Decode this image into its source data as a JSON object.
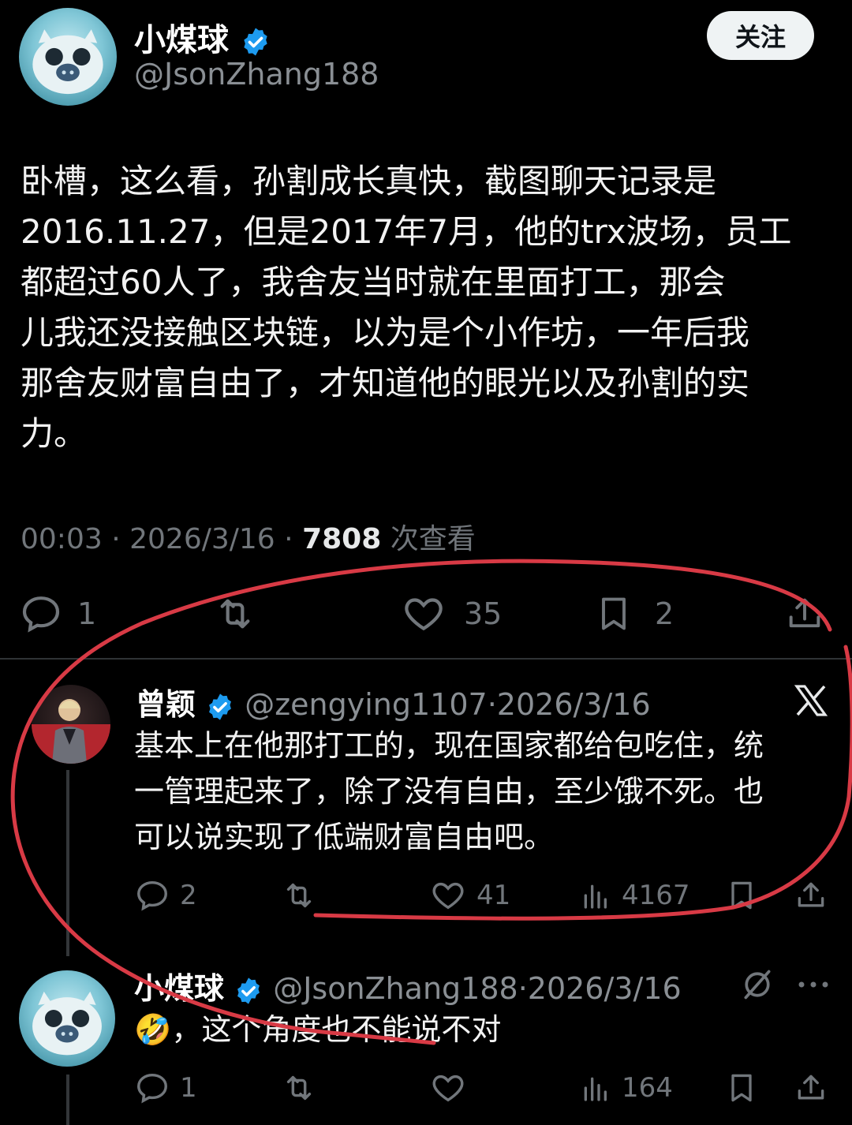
{
  "main_tweet": {
    "display_name": "小煤球",
    "handle": "@JsonZhang188",
    "follow_label": "关注",
    "text": "卧槽，这么看，孙割成长真快，截图聊天记录是\n2016.11.27，但是2017年7月，他的trx波场，员工\n都超过60人了，我舍友当时就在里面打工，那会\n儿我还没接触区块链，以为是个小作坊，一年后我\n那舍友财富自由了，才知道他的眼光以及孙割的实\n力。",
    "time": "00:03",
    "date": "2026/3/16",
    "views_count": "7808",
    "views_label": "次查看",
    "replies": "1",
    "likes": "35",
    "bookmarks": "2"
  },
  "reply_1": {
    "display_name": "曾颖",
    "handle": "@zengying1107",
    "date": "2026/3/16",
    "text": "基本上在他那打工的，现在国家都给包吃住，统\n一管理起来了，除了没有自由，至少饿不死。也\n可以说实现了低端财富自由吧。",
    "replies": "2",
    "likes": "41",
    "views": "4167"
  },
  "reply_2": {
    "display_name": "小煤球",
    "handle": "@JsonZhang188",
    "date": "2026/3/16",
    "text": "🤣，这个角度也不能说不对",
    "replies": "1",
    "views": "164"
  },
  "separator": "·",
  "colors": {
    "background": "#000000",
    "verified": "#1d9bf0",
    "muted_text": "#71767b",
    "annotation": "#d83a45"
  }
}
